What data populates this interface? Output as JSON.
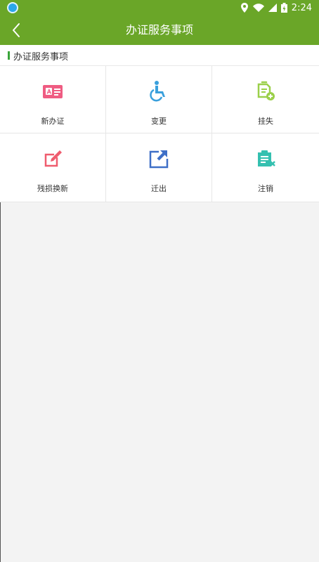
{
  "status_bar": {
    "time": "2:24",
    "icons": [
      "app-icon",
      "location-icon",
      "wifi-icon",
      "signal-icon",
      "battery-icon"
    ],
    "color": "#6aa628"
  },
  "app_bar": {
    "title": "办证服务事项",
    "back_icon": "chevron-left-icon",
    "color": "#6aa628"
  },
  "section": {
    "title": "办证服务事项",
    "marker_color": "#3aa53a"
  },
  "services": [
    {
      "label": "新办证",
      "icon": "id-card-icon",
      "color": "#ef5c82"
    },
    {
      "label": "变更",
      "icon": "wheelchair-icon",
      "color": "#3aa0dc"
    },
    {
      "label": "挂失",
      "icon": "document-add-icon",
      "color": "#9bd04a"
    },
    {
      "label": "残损换新",
      "icon": "edit-icon",
      "color": "#ef5c6e"
    },
    {
      "label": "迁出",
      "icon": "move-out-icon",
      "color": "#3e6fc7"
    },
    {
      "label": "注销",
      "icon": "clipboard-cancel-icon",
      "color": "#35c0b0"
    }
  ]
}
